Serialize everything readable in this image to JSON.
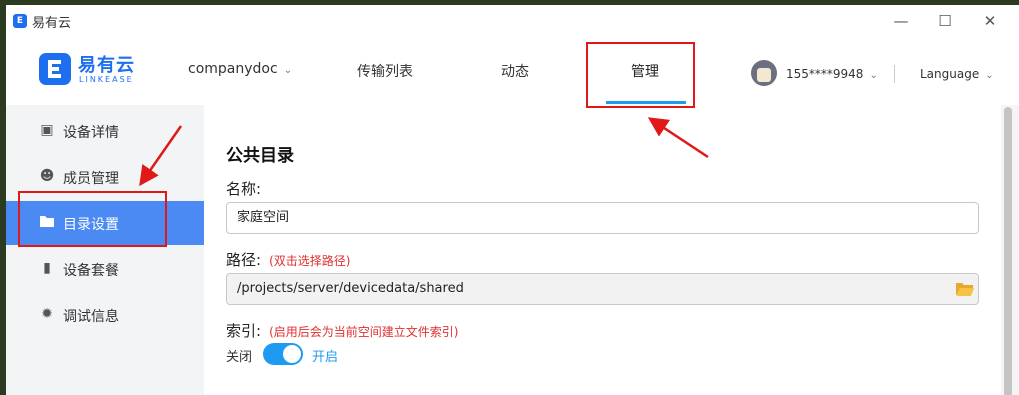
{
  "window": {
    "title": "易有云"
  },
  "header": {
    "brand_name": "易有云",
    "brand_sub": "LINKEASE",
    "nav": {
      "company": "companydoc",
      "transfer": "传输列表",
      "activity": "动态",
      "manage": "管理"
    },
    "user": "155****9948",
    "language": "Language"
  },
  "sidebar": {
    "items": [
      {
        "label": "设备详情",
        "icon": "router-icon"
      },
      {
        "label": "成员管理",
        "icon": "user-icon"
      },
      {
        "label": "目录设置",
        "icon": "folder-icon"
      },
      {
        "label": "设备套餐",
        "icon": "package-icon"
      },
      {
        "label": "调试信息",
        "icon": "bug-icon"
      }
    ],
    "active_index": 2
  },
  "content": {
    "section_title": "公共目录",
    "name_label": "名称:",
    "name_value": "家庭空间",
    "path_label": "路径:",
    "path_hint": "(双击选择路径)",
    "path_value": "/projects/server/devicedata/shared",
    "index_label": "索引:",
    "index_hint": "(启用后会为当前空间建立文件索引)",
    "toggle_off": "关闭",
    "toggle_on": "开启",
    "index_enabled": true
  },
  "colors": {
    "accent": "#1e9bf0",
    "brand": "#1e6ff0",
    "sidebar_active": "#4b8af3",
    "annotation": "#e01818"
  }
}
